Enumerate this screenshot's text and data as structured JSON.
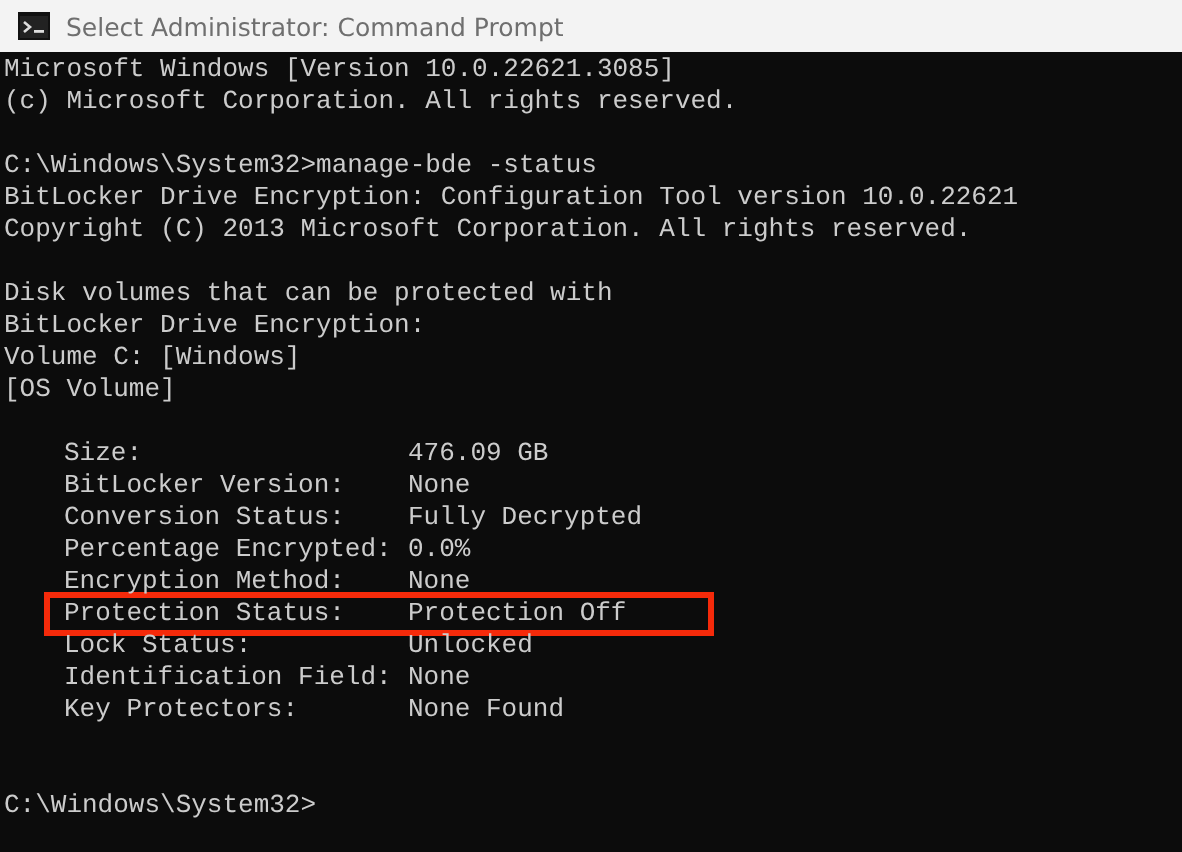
{
  "window": {
    "title": "Select Administrator: Command Prompt"
  },
  "console": {
    "blocks": [
      {
        "lines": [
          "Microsoft Windows [Version 10.0.22621.3085]",
          "(c) Microsoft Corporation. All rights reserved."
        ]
      },
      {
        "lines": [
          "C:\\Windows\\System32>manage-bde -status",
          "BitLocker Drive Encryption: Configuration Tool version 10.0.22621",
          "Copyright (C) 2013 Microsoft Corporation. All rights reserved."
        ]
      },
      {
        "lines": [
          "Disk volumes that can be protected with",
          "BitLocker Drive Encryption:",
          "Volume C: [Windows]",
          "[OS Volume]"
        ]
      }
    ],
    "fields": [
      {
        "label": "Size:",
        "value": "476.09 GB",
        "highlighted": false
      },
      {
        "label": "BitLocker Version:",
        "value": "None",
        "highlighted": false
      },
      {
        "label": "Conversion Status:",
        "value": "Fully Decrypted",
        "highlighted": false
      },
      {
        "label": "Percentage Encrypted:",
        "value": "0.0%",
        "highlighted": false
      },
      {
        "label": "Encryption Method:",
        "value": "None",
        "highlighted": false
      },
      {
        "label": "Protection Status:",
        "value": "Protection Off",
        "highlighted": true
      },
      {
        "label": "Lock Status:",
        "value": "Unlocked",
        "highlighted": false
      },
      {
        "label": "Identification Field:",
        "value": "None",
        "highlighted": false
      },
      {
        "label": "Key Protectors:",
        "value": "None Found",
        "highlighted": false
      }
    ],
    "prompt": "C:\\Windows\\System32>"
  }
}
